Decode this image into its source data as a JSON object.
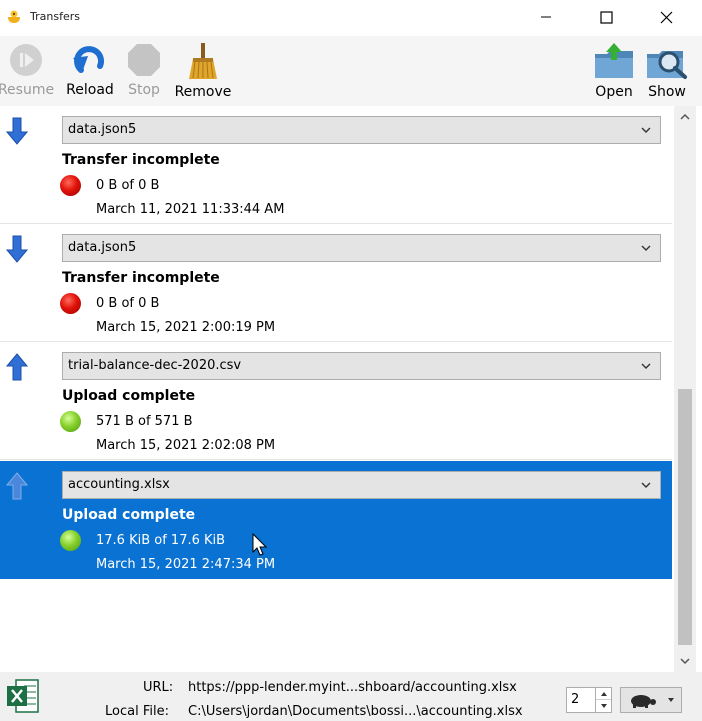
{
  "window": {
    "title": "Transfers"
  },
  "toolbar": {
    "resume": "Resume",
    "reload": "Reload",
    "stop": "Stop",
    "remove": "Remove",
    "open": "Open",
    "show": "Show"
  },
  "transfers": [
    {
      "direction": "download",
      "file": "data.json5",
      "status": "Transfer incomplete",
      "state": "error",
      "size": "0 B of 0 B",
      "date": "March 11, 2021 11:33:44 AM",
      "selected": false
    },
    {
      "direction": "download",
      "file": "data.json5",
      "status": "Transfer incomplete",
      "state": "error",
      "size": "0 B of 0 B",
      "date": "March 15, 2021 2:00:19 PM",
      "selected": false
    },
    {
      "direction": "upload",
      "file": "trial-balance-dec-2020.csv",
      "status": "Upload complete",
      "state": "complete",
      "size": "571 B of 571 B",
      "date": "March 15, 2021 2:02:08 PM",
      "selected": false
    },
    {
      "direction": "upload",
      "file": "accounting.xlsx",
      "status": "Upload complete",
      "state": "complete",
      "size": "17.6 KiB of 17.6 KiB",
      "date": "March 15, 2021 2:47:34 PM",
      "selected": true
    }
  ],
  "footer": {
    "url_label": "URL:",
    "url_value": "https://ppp-lender.myint...shboard/accounting.xlsx",
    "local_label": "Local File:",
    "local_value": "C:\\Users\\jordan\\Documents\\bossi...\\accounting.xlsx",
    "connections": "2"
  },
  "colors": {
    "selection": "#0a72d2",
    "accent_arrow": "#2f6fd6",
    "error": "#e0120a",
    "success": "#86d02c"
  },
  "icons": [
    "app-icon",
    "minimize-icon",
    "maximize-icon",
    "close-icon",
    "resume-icon",
    "reload-icon",
    "stop-icon",
    "remove-broom-icon",
    "open-folder-icon",
    "show-folder-icon",
    "download-arrow-icon",
    "upload-arrow-icon",
    "chevron-down-icon",
    "excel-file-icon",
    "turtle-icon"
  ]
}
